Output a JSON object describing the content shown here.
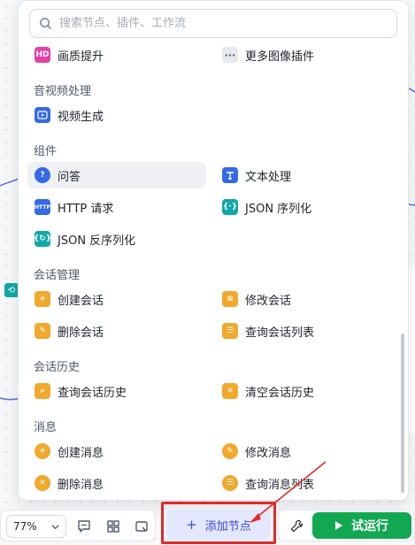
{
  "search": {
    "placeholder": "搜索节点、插件、工作流"
  },
  "sections": {
    "top_items": [
      {
        "label": "画质提升",
        "icon": "hd-icon",
        "color": "#e63fa5"
      },
      {
        "label": "更多图像插件",
        "icon": "ellipsis-icon",
        "color": "#e8eaef"
      }
    ],
    "audio_video": {
      "title": "音视频处理",
      "items": [
        {
          "label": "视频生成",
          "icon": "video-icon",
          "color": "#3569e7"
        }
      ]
    },
    "components": {
      "title": "组件",
      "items": [
        {
          "label": "问答",
          "icon": "question-icon",
          "color": "#3569e7"
        },
        {
          "label": "文本处理",
          "icon": "text-process-icon",
          "color": "#3569e7"
        },
        {
          "label": "HTTP 请求",
          "icon": "http-icon",
          "color": "#3569e7"
        },
        {
          "label": "JSON 序列化",
          "icon": "json-serialize-icon",
          "color": "#13a8a8"
        },
        {
          "label": "JSON 反序列化",
          "icon": "json-deserialize-icon",
          "color": "#13a8a8"
        }
      ]
    },
    "conversation_mgmt": {
      "title": "会话管理",
      "items": [
        {
          "label": "创建会话",
          "icon": "create-conversation-icon",
          "color": "#f0a92c"
        },
        {
          "label": "修改会话",
          "icon": "edit-conversation-icon",
          "color": "#f0a92c"
        },
        {
          "label": "删除会话",
          "icon": "delete-conversation-icon",
          "color": "#f0a92c"
        },
        {
          "label": "查询会话列表",
          "icon": "list-conversation-icon",
          "color": "#f0a92c"
        }
      ]
    },
    "conversation_history": {
      "title": "会话历史",
      "items": [
        {
          "label": "查询会话历史",
          "icon": "query-history-icon",
          "color": "#f0a92c"
        },
        {
          "label": "清空会话历史",
          "icon": "clear-history-icon",
          "color": "#f0a92c"
        }
      ]
    },
    "messages": {
      "title": "消息",
      "items": [
        {
          "label": "创建消息",
          "icon": "create-message-icon",
          "color": "#f0a92c"
        },
        {
          "label": "修改消息",
          "icon": "edit-message-icon",
          "color": "#f0a92c"
        },
        {
          "label": "删除消息",
          "icon": "delete-message-icon",
          "color": "#f0a92c"
        },
        {
          "label": "查询消息列表",
          "icon": "list-message-icon",
          "color": "#f0a92c"
        }
      ]
    }
  },
  "toolbar": {
    "zoom": "77%",
    "add_node_label": "添加节点",
    "run_label": "试运行"
  },
  "colors": {
    "accent": "#3b47d6",
    "run_green": "#12a852",
    "highlight_red": "#e02a2a"
  }
}
